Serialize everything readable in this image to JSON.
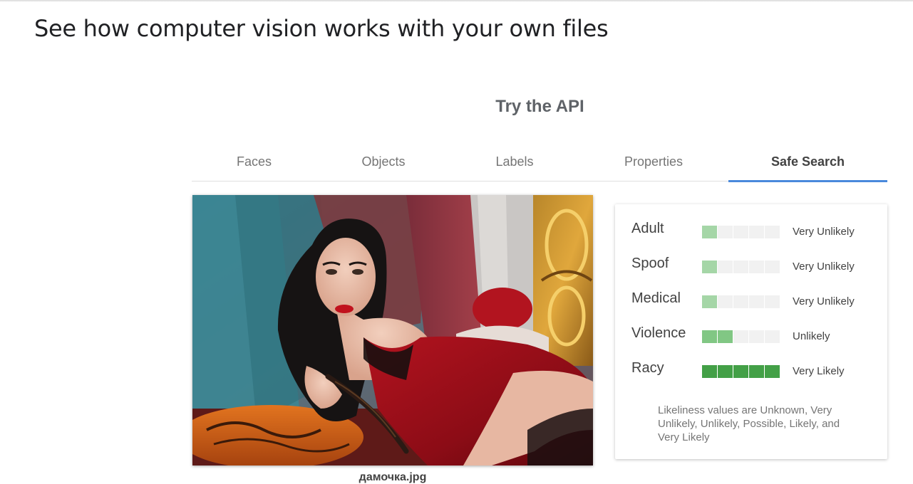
{
  "page": {
    "heading": "See how computer vision works with your own files"
  },
  "section": {
    "title": "Try the API"
  },
  "tabs": [
    {
      "label": "Faces",
      "active": false
    },
    {
      "label": "Objects",
      "active": false
    },
    {
      "label": "Labels",
      "active": false
    },
    {
      "label": "Properties",
      "active": false
    },
    {
      "label": "Safe Search",
      "active": true
    }
  ],
  "image": {
    "file_name": "дамочка.jpg"
  },
  "safe_search": {
    "rows": [
      {
        "label": "Adult",
        "value": "Very Unlikely",
        "level": 1
      },
      {
        "label": "Spoof",
        "value": "Very Unlikely",
        "level": 1
      },
      {
        "label": "Medical",
        "value": "Very Unlikely",
        "level": 1
      },
      {
        "label": "Violence",
        "value": "Unlikely",
        "level": 2
      },
      {
        "label": "Racy",
        "value": "Very Likely",
        "level": 5
      }
    ],
    "note": "Likeliness values are Unknown, Very Unlikely, Unlikely, Possible, Likely, and Very Likely"
  },
  "colors": {
    "accent": "#4a89dc",
    "level_very_unlikely": "#a5d6a7",
    "level_unlikely": "#81c784",
    "level_very_likely": "#43a047",
    "segment_empty": "#f1f1f1"
  }
}
